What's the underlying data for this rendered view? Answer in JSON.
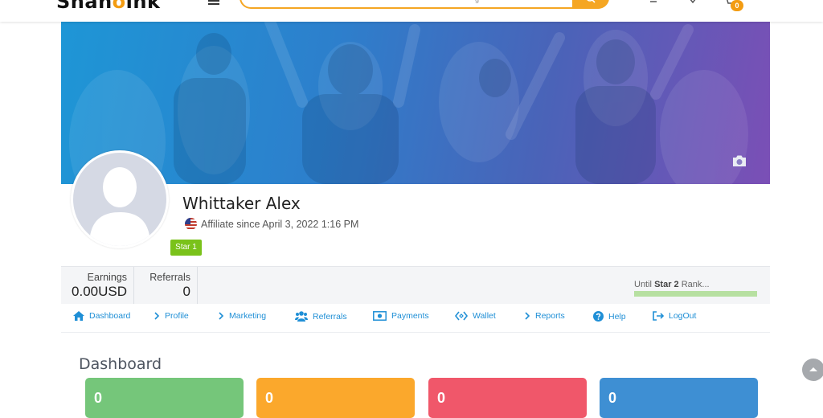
{
  "header": {
    "logo_text": "ShaHoink",
    "search_placeholder": "g",
    "cart_count": "0"
  },
  "profile": {
    "name": "Whittaker Alex",
    "since": "Affiliate since April 3, 2022 1:16 PM",
    "rank_badge": "Star 1"
  },
  "stats": {
    "earnings_label": "Earnings",
    "earnings_value": "0.00USD",
    "referrals_label": "Referrals",
    "referrals_value": "0",
    "until_prefix": "Until",
    "until_rank": "Star 2",
    "until_suffix": "Rank..."
  },
  "nav": {
    "items": [
      {
        "label": "Dashboard",
        "icon": "home-icon"
      },
      {
        "label": "Profile",
        "icon": "chevron-right-icon"
      },
      {
        "label": "Marketing",
        "icon": "chevron-right-icon"
      },
      {
        "label": "Referrals",
        "icon": "users-icon"
      },
      {
        "label": "Payments",
        "icon": "money-icon"
      },
      {
        "label": "Wallet",
        "icon": "code-icon"
      },
      {
        "label": "Reports",
        "icon": "chevron-right-icon"
      },
      {
        "label": "Help",
        "icon": "question-icon"
      },
      {
        "label": "LogOut",
        "icon": "logout-icon"
      }
    ]
  },
  "dashboard": {
    "title": "Dashboard",
    "cards": [
      {
        "value": "0",
        "color": "#75c67a"
      },
      {
        "value": "0",
        "color": "#fba82c"
      },
      {
        "value": "0",
        "color": "#f0576a"
      },
      {
        "value": "0",
        "color": "#3e8fd3"
      }
    ]
  },
  "colors": {
    "accent": "#f5a623",
    "link": "#1f8fd6",
    "rank_badge": "#7ac21a",
    "progress": "#b7e0a1"
  }
}
